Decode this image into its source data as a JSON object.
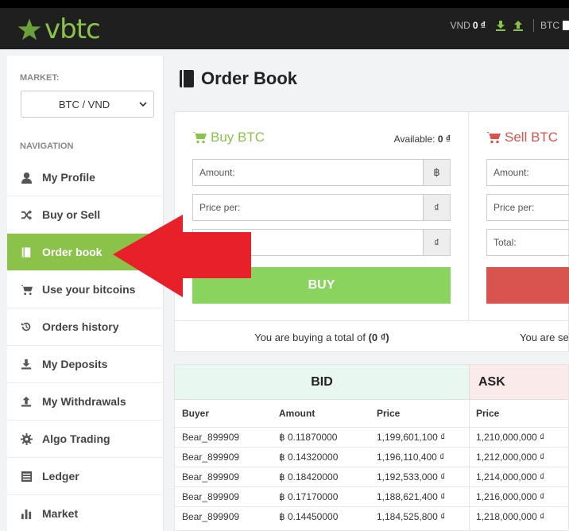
{
  "brand": {
    "name": "vbtc",
    "color": "#8bc34a"
  },
  "header": {
    "vnd_label": "VND",
    "vnd_value": "0 ₫",
    "btc_label": "BTC"
  },
  "sidebar": {
    "market_label": "MARKET:",
    "market_selected": "BTC / VND",
    "nav_label": "NAVIGATION",
    "items": [
      {
        "label": "My Profile",
        "icon": "user-icon"
      },
      {
        "label": "Buy or Sell",
        "icon": "shuffle-icon"
      },
      {
        "label": "Order book",
        "icon": "book-icon",
        "active": true
      },
      {
        "label": "Use your bitcoins",
        "icon": "cart-icon"
      },
      {
        "label": "Orders history",
        "icon": "history-icon"
      },
      {
        "label": "My Deposits",
        "icon": "download-icon"
      },
      {
        "label": "My Withdrawals",
        "icon": "upload-icon"
      },
      {
        "label": "Algo Trading",
        "icon": "gear-icon"
      },
      {
        "label": "Ledger",
        "icon": "ledger-icon"
      },
      {
        "label": "Market",
        "icon": "bar-chart-icon"
      }
    ]
  },
  "page": {
    "title": "Order Book"
  },
  "buy": {
    "title": "Buy BTC",
    "available_label": "Available:",
    "available_value": "0 ₫",
    "amount_label": "Amount:",
    "amount_unit": "฿",
    "price_label": "Price per:",
    "price_unit": "₫",
    "total_unit": "₫",
    "button": "BUY",
    "summary_prefix": "You are buying a total of",
    "summary_value": "(0 ₫)"
  },
  "sell": {
    "title": "Sell BTC",
    "amount_label": "Amount:",
    "price_label": "Price per:",
    "total_label": "Total:",
    "summary_prefix": "You are se"
  },
  "book": {
    "bid_title": "BID",
    "ask_title": "ASK",
    "columns": {
      "buyer": "Buyer",
      "amount": "Amount",
      "price": "Price",
      "ask_price": "Price"
    },
    "rows": [
      {
        "buyer": "Bear_899909",
        "amount": "฿ 0.11870000",
        "price": "1,199,601,100 ₫",
        "ask_price": "1,210,000,000 ₫"
      },
      {
        "buyer": "Bear_899909",
        "amount": "฿ 0.14320000",
        "price": "1,196,110,400 ₫",
        "ask_price": "1,212,000,000 ₫"
      },
      {
        "buyer": "Bear_899909",
        "amount": "฿ 0.18420000",
        "price": "1,192,533,000 ₫",
        "ask_price": "1,214,000,000 ₫"
      },
      {
        "buyer": "Bear_899909",
        "amount": "฿ 0.17170000",
        "price": "1,188,621,400 ₫",
        "ask_price": "1,216,000,000 ₫"
      },
      {
        "buyer": "Bear_899909",
        "amount": "฿ 0.14450000",
        "price": "1,184,525,800 ₫",
        "ask_price": "1,218,000,000 ₫"
      }
    ]
  },
  "colors": {
    "accent": "#8bc34a",
    "buy": "#8bd35f",
    "sell": "#d9534f",
    "annotation_arrow": "#e8202a"
  }
}
